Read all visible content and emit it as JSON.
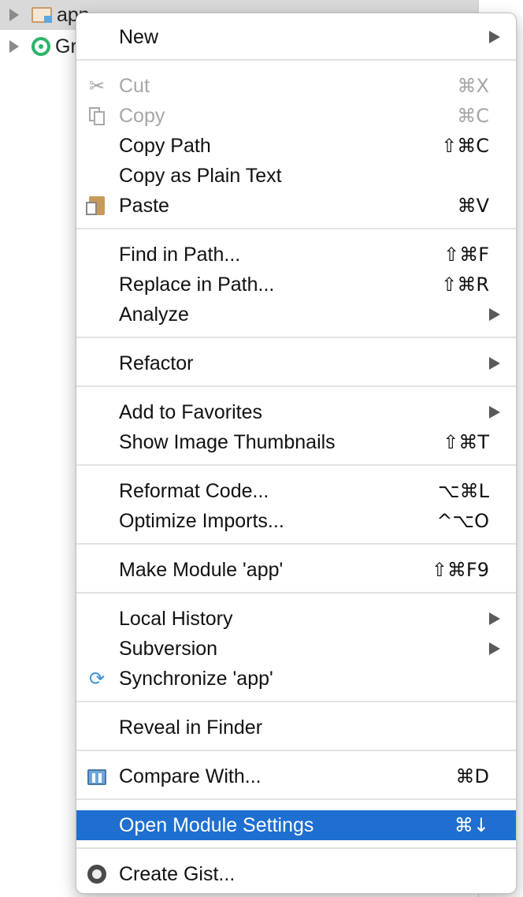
{
  "tree": {
    "rows": [
      {
        "label": "app"
      },
      {
        "label": "Gradle Scripts"
      }
    ]
  },
  "menu": {
    "new": {
      "label": "New"
    },
    "cut": {
      "label": "Cut",
      "shortcut": "⌘X"
    },
    "copy": {
      "label": "Copy",
      "shortcut": "⌘C"
    },
    "copy_path": {
      "label": "Copy Path",
      "shortcut": "⇧⌘C"
    },
    "copy_plain": {
      "label": "Copy as Plain Text"
    },
    "paste": {
      "label": "Paste",
      "shortcut": "⌘V"
    },
    "find_in_path": {
      "label": "Find in Path...",
      "shortcut": "⇧⌘F"
    },
    "replace_in_path": {
      "label": "Replace in Path...",
      "shortcut": "⇧⌘R"
    },
    "analyze": {
      "label": "Analyze"
    },
    "refactor": {
      "label": "Refactor"
    },
    "add_favorites": {
      "label": "Add to Favorites"
    },
    "thumbnails": {
      "label": "Show Image Thumbnails",
      "shortcut": "⇧⌘T"
    },
    "reformat": {
      "label": "Reformat Code...",
      "shortcut": "⌥⌘L"
    },
    "optimize": {
      "label": "Optimize Imports...",
      "shortcut": "^⌥O"
    },
    "make_module": {
      "label": "Make Module 'app'",
      "shortcut": "⇧⌘F9"
    },
    "local_history": {
      "label": "Local History"
    },
    "subversion": {
      "label": "Subversion"
    },
    "synchronize": {
      "label": "Synchronize 'app'"
    },
    "reveal": {
      "label": "Reveal in Finder"
    },
    "compare": {
      "label": "Compare With...",
      "shortcut": "⌘D"
    },
    "module_settings": {
      "label": "Open Module Settings",
      "shortcut": "⌘↓"
    },
    "create_gist": {
      "label": "Create Gist..."
    }
  },
  "colors": {
    "highlight": "#1e6fd0",
    "disabled_text": "#a6a6a6",
    "separator": "#e2e2e2"
  }
}
